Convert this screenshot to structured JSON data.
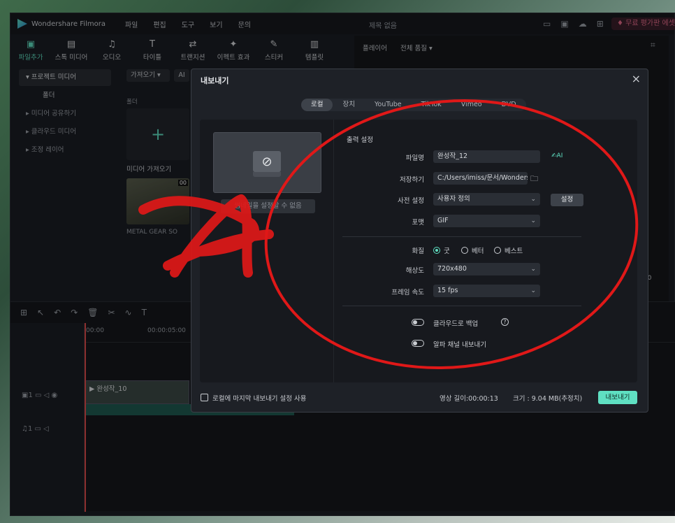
{
  "app": {
    "name": "Wondershare Filmora",
    "menu": [
      "파일",
      "편집",
      "도구",
      "보기",
      "문의"
    ],
    "project_title": "제목 없음",
    "promo": "무료 평가판 에셋"
  },
  "toolbar": {
    "items": [
      {
        "label": "파일추가",
        "icon": "media-icon"
      },
      {
        "label": "스톡 미디어",
        "icon": "stock-icon"
      },
      {
        "label": "오디오",
        "icon": "music-icon"
      },
      {
        "label": "타이틀",
        "icon": "text-icon"
      },
      {
        "label": "트랜지션",
        "icon": "transition-icon"
      },
      {
        "label": "이펙트 효과",
        "icon": "effect-icon"
      },
      {
        "label": "스티커",
        "icon": "sticker-icon"
      },
      {
        "label": "템플릿",
        "icon": "template-icon"
      }
    ]
  },
  "sidebar": {
    "items": [
      "프로젝트 미디어",
      "폴더",
      "미디어 공유하기",
      "클라우드 미디어",
      "조정 레이어"
    ]
  },
  "media": {
    "import_label": "가져오기",
    "ai_label": "AI",
    "folder_label": "폴더",
    "import_media": "미디어 가져오기",
    "clip_name": "METAL GEAR SO",
    "clip_badge": "00"
  },
  "player": {
    "label": "플레이어",
    "quality": "전체 품질",
    "time_suffix": "00"
  },
  "timeline": {
    "ruler": [
      "00:00",
      "00:00:05:00"
    ],
    "clip_name": "완성작_10"
  },
  "dialog": {
    "title": "내보내기",
    "tabs": [
      "로컬",
      "장치",
      "YouTube",
      "TikTok",
      "Vimeo",
      "DVD"
    ],
    "preview_error": "썸네일을 설정할 수 없음",
    "section_title": "출력 설정",
    "filename_label": "파일명",
    "filename_value": "완성작_12",
    "save_label": "저장하기",
    "save_value": "C:/Users/imiss/문서/Wonders",
    "preset_label": "사전 설정",
    "preset_value": "사용자 정의",
    "settings_button": "설정",
    "format_label": "포맷",
    "format_value": "GIF",
    "quality_label": "화질",
    "quality_options": [
      "굿",
      "베터",
      "베스트"
    ],
    "resolution_label": "해상도",
    "resolution_value": "720x480",
    "framerate_label": "프레임 속도",
    "framerate_value": "15 fps",
    "cloud_backup_label": "클라우드로 백업",
    "alpha_label": "알파 채널 내보내기",
    "footer_checkbox": "로컬에 마지막 내보내기 설정 사용",
    "duration": "영상 길이:00:00:13",
    "size": "크기 : 9.04 MB(추정치)",
    "export_button": "내보내기"
  }
}
